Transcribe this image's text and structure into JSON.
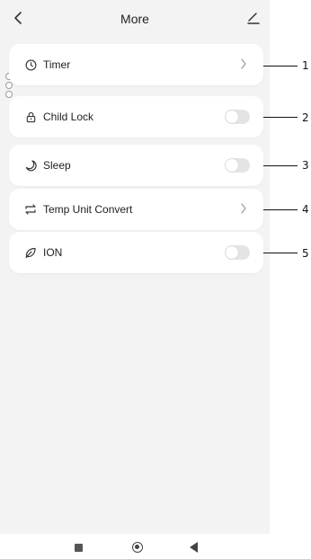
{
  "header": {
    "title": "More",
    "back_icon": "chevron-left-icon",
    "edit_icon": "edit-icon"
  },
  "items": [
    {
      "label": "Timer",
      "icon": "clock-icon",
      "control": "chevron"
    },
    {
      "label": "Child Lock",
      "icon": "lock-icon",
      "control": "toggle",
      "on": false
    },
    {
      "label": "Sleep",
      "icon": "moon-icon",
      "control": "toggle",
      "on": false
    },
    {
      "label": "Temp Unit Convert",
      "icon": "convert-icon",
      "control": "chevron"
    },
    {
      "label": "ION",
      "icon": "leaf-icon",
      "control": "toggle",
      "on": false
    }
  ],
  "callouts": [
    "1",
    "2",
    "3",
    "4",
    "5"
  ],
  "nav": {
    "recents": "square-icon",
    "home": "circle-icon",
    "back": "triangle-back-icon"
  }
}
